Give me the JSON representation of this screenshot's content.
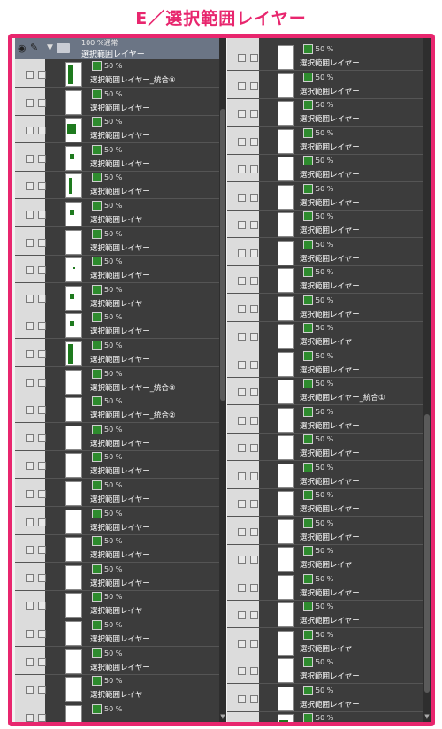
{
  "title": "E／選択範囲レイヤー",
  "folder": {
    "opacity": "100 %通常",
    "name": "選択範囲レイヤー"
  },
  "left_layers": [
    {
      "opacity": "50 %",
      "name": "選択範囲レイヤー_統合④",
      "mark": "tall"
    },
    {
      "opacity": "50 %",
      "name": "選択範囲レイヤー",
      "mark": "none"
    },
    {
      "opacity": "50 %",
      "name": "選択範囲レイヤー",
      "mark": "blob"
    },
    {
      "opacity": "50 %",
      "name": "選択範囲レイヤー",
      "mark": "small"
    },
    {
      "opacity": "50 %",
      "name": "選択範囲レイヤー",
      "mark": "tri"
    },
    {
      "opacity": "50 %",
      "name": "選択範囲レイヤー",
      "mark": "small"
    },
    {
      "opacity": "50 %",
      "name": "選択範囲レイヤー",
      "mark": "none"
    },
    {
      "opacity": "50 %",
      "name": "選択範囲レイヤー",
      "mark": "dot"
    },
    {
      "opacity": "50 %",
      "name": "選択範囲レイヤー",
      "mark": "small"
    },
    {
      "opacity": "50 %",
      "name": "選択範囲レイヤー",
      "mark": "small"
    },
    {
      "opacity": "50 %",
      "name": "選択範囲レイヤー",
      "mark": "tall"
    },
    {
      "opacity": "50 %",
      "name": "選択範囲レイヤー_統合③",
      "mark": "none"
    },
    {
      "opacity": "50 %",
      "name": "選択範囲レイヤー_統合②",
      "mark": "none"
    },
    {
      "opacity": "50 %",
      "name": "選択範囲レイヤー",
      "mark": "none"
    },
    {
      "opacity": "50 %",
      "name": "選択範囲レイヤー",
      "mark": "none"
    },
    {
      "opacity": "50 %",
      "name": "選択範囲レイヤー",
      "mark": "none"
    },
    {
      "opacity": "50 %",
      "name": "選択範囲レイヤー",
      "mark": "none"
    },
    {
      "opacity": "50 %",
      "name": "選択範囲レイヤー",
      "mark": "none"
    },
    {
      "opacity": "50 %",
      "name": "選択範囲レイヤー",
      "mark": "none"
    },
    {
      "opacity": "50 %",
      "name": "選択範囲レイヤー",
      "mark": "none"
    },
    {
      "opacity": "50 %",
      "name": "選択範囲レイヤー",
      "mark": "none"
    },
    {
      "opacity": "50 %",
      "name": "選択範囲レイヤー",
      "mark": "none"
    },
    {
      "opacity": "50 %",
      "name": "選択範囲レイヤー",
      "mark": "none"
    },
    {
      "opacity": "50 %",
      "name": "",
      "mark": "none"
    }
  ],
  "right_layers": [
    {
      "opacity": "50 %",
      "name": "選択範囲レイヤー",
      "mark": "none"
    },
    {
      "opacity": "50 %",
      "name": "選択範囲レイヤー",
      "mark": "none"
    },
    {
      "opacity": "50 %",
      "name": "選択範囲レイヤー",
      "mark": "none"
    },
    {
      "opacity": "50 %",
      "name": "選択範囲レイヤー",
      "mark": "none"
    },
    {
      "opacity": "50 %",
      "name": "選択範囲レイヤー",
      "mark": "none"
    },
    {
      "opacity": "50 %",
      "name": "選択範囲レイヤー",
      "mark": "none"
    },
    {
      "opacity": "50 %",
      "name": "選択範囲レイヤー",
      "mark": "none"
    },
    {
      "opacity": "50 %",
      "name": "選択範囲レイヤー",
      "mark": "none"
    },
    {
      "opacity": "50 %",
      "name": "選択範囲レイヤー",
      "mark": "none"
    },
    {
      "opacity": "50 %",
      "name": "選択範囲レイヤー",
      "mark": "none"
    },
    {
      "opacity": "50 %",
      "name": "選択範囲レイヤー",
      "mark": "none"
    },
    {
      "opacity": "50 %",
      "name": "選択範囲レイヤー",
      "mark": "none"
    },
    {
      "opacity": "50 %",
      "name": "選択範囲レイヤー_統合①",
      "mark": "none"
    },
    {
      "opacity": "50 %",
      "name": "選択範囲レイヤー",
      "mark": "none"
    },
    {
      "opacity": "50 %",
      "name": "選択範囲レイヤー",
      "mark": "none"
    },
    {
      "opacity": "50 %",
      "name": "選択範囲レイヤー",
      "mark": "none"
    },
    {
      "opacity": "50 %",
      "name": "選択範囲レイヤー",
      "mark": "none"
    },
    {
      "opacity": "50 %",
      "name": "選択範囲レイヤー",
      "mark": "none"
    },
    {
      "opacity": "50 %",
      "name": "選択範囲レイヤー",
      "mark": "none"
    },
    {
      "opacity": "50 %",
      "name": "選択範囲レイヤー",
      "mark": "none"
    },
    {
      "opacity": "50 %",
      "name": "選択範囲レイヤー",
      "mark": "none"
    },
    {
      "opacity": "50 %",
      "name": "選択範囲レイヤー",
      "mark": "none"
    },
    {
      "opacity": "50 %",
      "name": "選択範囲レイヤー",
      "mark": "none"
    },
    {
      "opacity": "50 %",
      "name": "選択範囲レイヤー",
      "mark": "none"
    },
    {
      "opacity": "50 %",
      "name": "",
      "mark": "blob"
    }
  ],
  "colors": {
    "accent": "#e8266e",
    "panel": "#3c3c3c",
    "mask": "#2e8b2e"
  }
}
